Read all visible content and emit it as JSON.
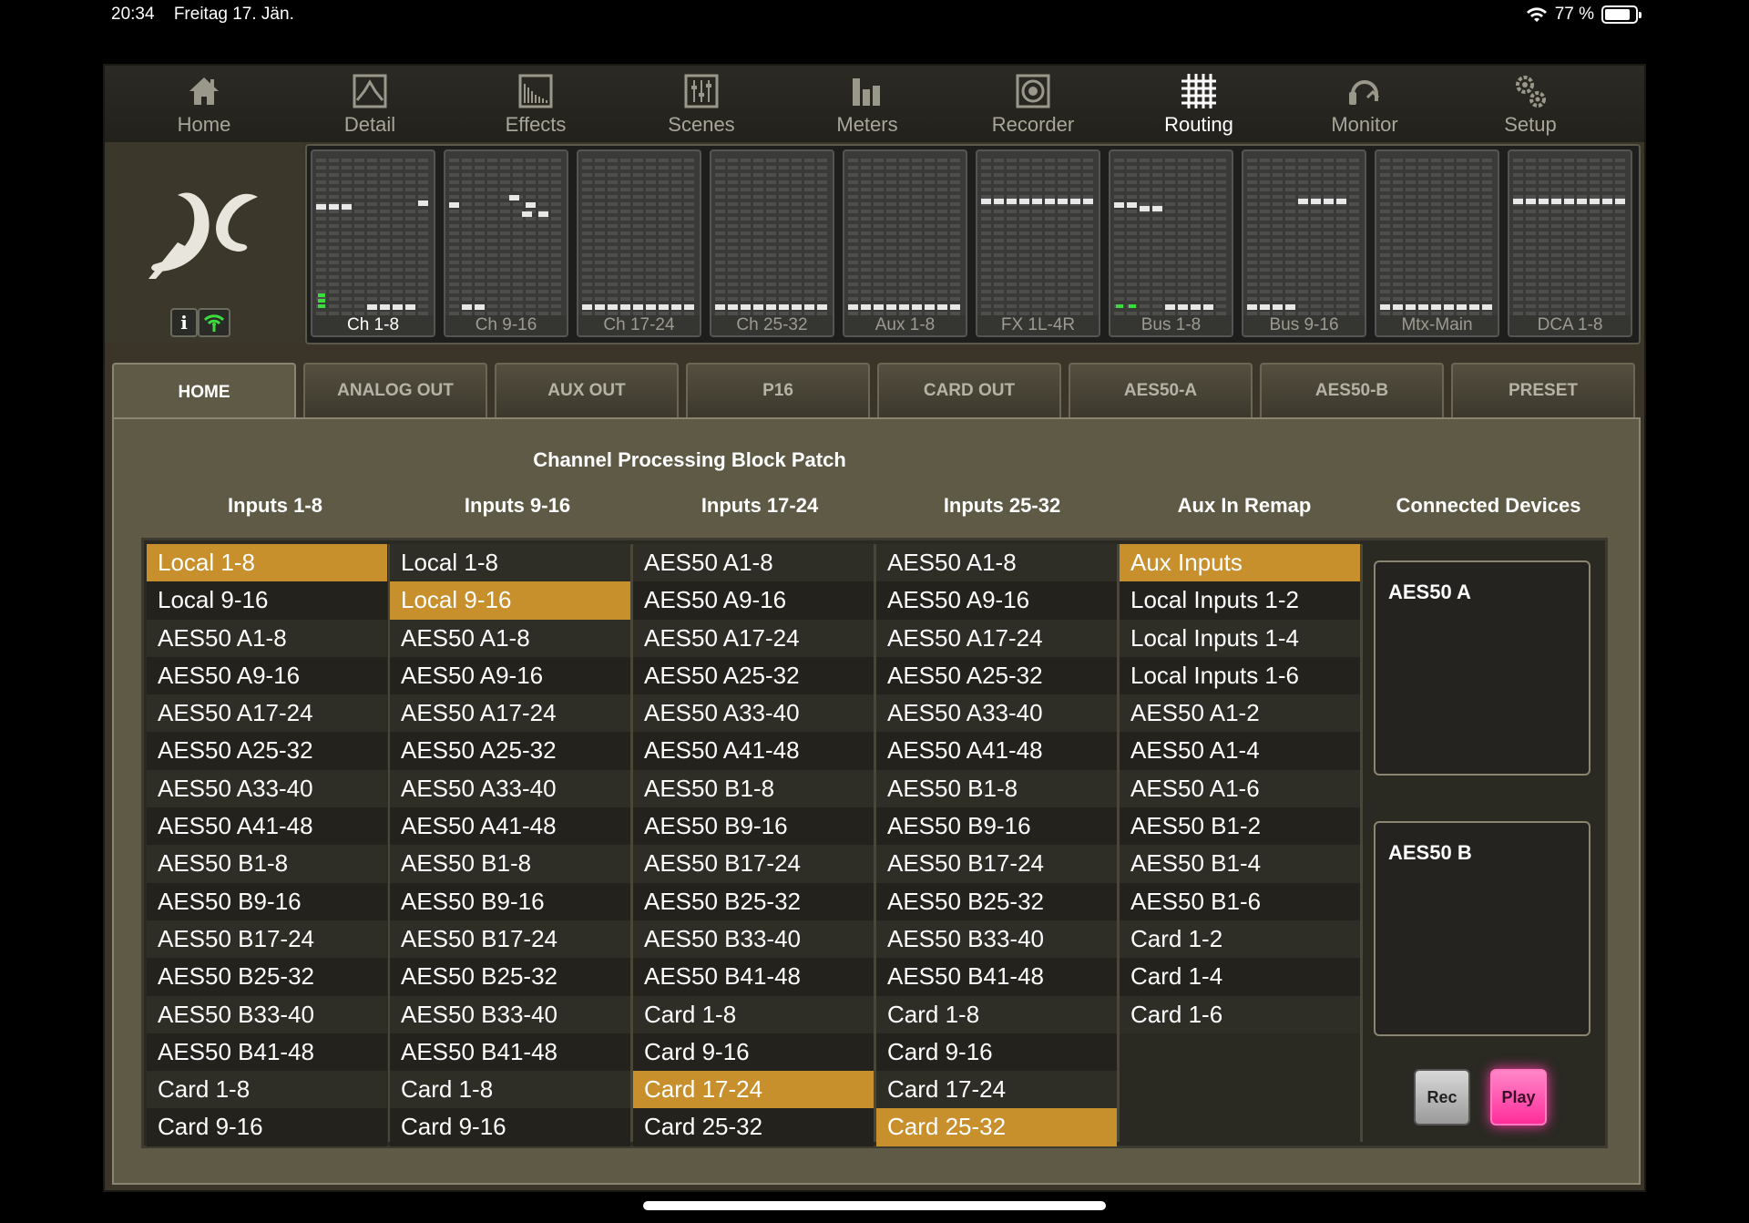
{
  "status_bar": {
    "time": "20:34",
    "date": "Freitag 17. Jän.",
    "battery": "77 %"
  },
  "nav": [
    {
      "label": "Home",
      "icon": "home-icon"
    },
    {
      "label": "Detail",
      "icon": "detail-icon"
    },
    {
      "label": "Effects",
      "icon": "effects-icon"
    },
    {
      "label": "Scenes",
      "icon": "scenes-icon"
    },
    {
      "label": "Meters",
      "icon": "meters-icon"
    },
    {
      "label": "Recorder",
      "icon": "recorder-icon"
    },
    {
      "label": "Routing",
      "icon": "routing-icon",
      "active": true
    },
    {
      "label": "Monitor",
      "icon": "monitor-icon"
    },
    {
      "label": "Setup",
      "icon": "setup-icon"
    }
  ],
  "banks": [
    {
      "label": "Ch 1-8",
      "active": true
    },
    {
      "label": "Ch 9-16"
    },
    {
      "label": "Ch 17-24"
    },
    {
      "label": "Ch 25-32"
    },
    {
      "label": "Aux 1-8"
    },
    {
      "label": "FX 1L-4R"
    },
    {
      "label": "Bus 1-8"
    },
    {
      "label": "Bus 9-16"
    },
    {
      "label": "Mtx-Main"
    },
    {
      "label": "DCA 1-8"
    }
  ],
  "info_button": "i",
  "tabs": [
    "HOME",
    "ANALOG OUT",
    "AUX OUT",
    "P16",
    "CARD OUT",
    "AES50-A",
    "AES50-B",
    "PRESET"
  ],
  "active_tab": "HOME",
  "panel": {
    "title": "Channel Processing Block Patch",
    "columns": [
      {
        "header": "Inputs 1-8",
        "selected": "Local 1-8",
        "items": [
          "Local 1-8",
          "Local 9-16",
          "AES50 A1-8",
          "AES50 A9-16",
          "AES50 A17-24",
          "AES50 A25-32",
          "AES50 A33-40",
          "AES50 A41-48",
          "AES50 B1-8",
          "AES50 B9-16",
          "AES50 B17-24",
          "AES50 B25-32",
          "AES50 B33-40",
          "AES50 B41-48",
          "Card 1-8",
          "Card 9-16"
        ]
      },
      {
        "header": "Inputs 9-16",
        "selected": "Local 9-16",
        "items": [
          "Local 1-8",
          "Local 9-16",
          "AES50 A1-8",
          "AES50 A9-16",
          "AES50 A17-24",
          "AES50 A25-32",
          "AES50 A33-40",
          "AES50 A41-48",
          "AES50 B1-8",
          "AES50 B9-16",
          "AES50 B17-24",
          "AES50 B25-32",
          "AES50 B33-40",
          "AES50 B41-48",
          "Card 1-8",
          "Card 9-16"
        ]
      },
      {
        "header": "Inputs 17-24",
        "selected": "Card 17-24",
        "items": [
          "AES50 A1-8",
          "AES50 A9-16",
          "AES50 A17-24",
          "AES50 A25-32",
          "AES50 A33-40",
          "AES50 A41-48",
          "AES50 B1-8",
          "AES50 B9-16",
          "AES50 B17-24",
          "AES50 B25-32",
          "AES50 B33-40",
          "AES50 B41-48",
          "Card 1-8",
          "Card 9-16",
          "Card 17-24",
          "Card 25-32"
        ]
      },
      {
        "header": "Inputs 25-32",
        "selected": "Card 25-32",
        "items": [
          "AES50 A1-8",
          "AES50 A9-16",
          "AES50 A17-24",
          "AES50 A25-32",
          "AES50 A33-40",
          "AES50 A41-48",
          "AES50 B1-8",
          "AES50 B9-16",
          "AES50 B17-24",
          "AES50 B25-32",
          "AES50 B33-40",
          "AES50 B41-48",
          "Card 1-8",
          "Card 9-16",
          "Card 17-24",
          "Card 25-32"
        ]
      },
      {
        "header": "Aux In Remap",
        "selected": "Aux Inputs",
        "items": [
          "Aux Inputs",
          "Local Inputs 1-2",
          "Local Inputs 1-4",
          "Local Inputs 1-6",
          "AES50 A1-2",
          "AES50 A1-4",
          "AES50 A1-6",
          "AES50 B1-2",
          "AES50 B1-4",
          "AES50 B1-6",
          "Card 1-2",
          "Card 1-4",
          "Card 1-6"
        ]
      }
    ],
    "connected_devices": {
      "header": "Connected Devices",
      "devices": [
        "AES50 A",
        "AES50 B"
      ]
    },
    "rec_label": "Rec",
    "play_label": "Play"
  },
  "colors": {
    "selected": "#c88f2d",
    "panel": "#5f5a46",
    "play": "#ff2d9a"
  }
}
